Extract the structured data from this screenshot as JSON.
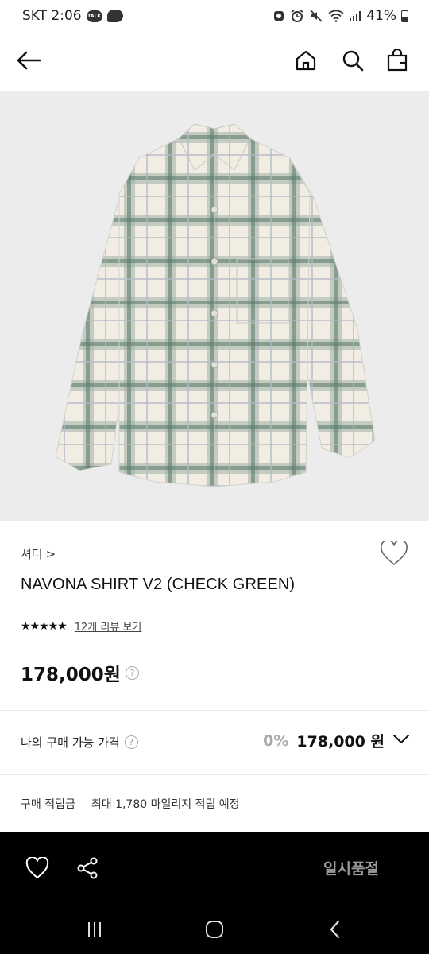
{
  "status_bar": {
    "carrier_time": "SKT 2:06",
    "talk_badge": "TALK",
    "battery": "41%"
  },
  "nav": {
    "icons": [
      "back-arrow-icon",
      "home-icon",
      "search-icon",
      "shopping-bag-icon"
    ]
  },
  "product": {
    "brand": "셔터",
    "brand_chevron": ">",
    "name": "NAVONA SHIRT V2 (CHECK GREEN)",
    "stars": "★★★★★",
    "review_link": "12개 리뷰 보기",
    "price": "178,000원",
    "help_mark": "?",
    "image_colors": {
      "base": "#f1ede3",
      "check_dark": "#5f7d70",
      "check_mid": "#9fb1a6",
      "background": "#ececec"
    }
  },
  "my_price": {
    "label": "나의 구매 가능 가격",
    "help_mark": "?",
    "discount": "0%",
    "value": "178,000 원"
  },
  "points": {
    "label": "구매 적립금",
    "value": "최대 1,780 마일리지 적립 예정"
  },
  "bottom_bar": {
    "soldout_label": "일시품절",
    "icons": [
      "heart-icon",
      "share-icon"
    ]
  },
  "system_nav": {
    "icons": [
      "recent-apps-icon",
      "home-circle-icon",
      "back-chevron-icon"
    ]
  }
}
